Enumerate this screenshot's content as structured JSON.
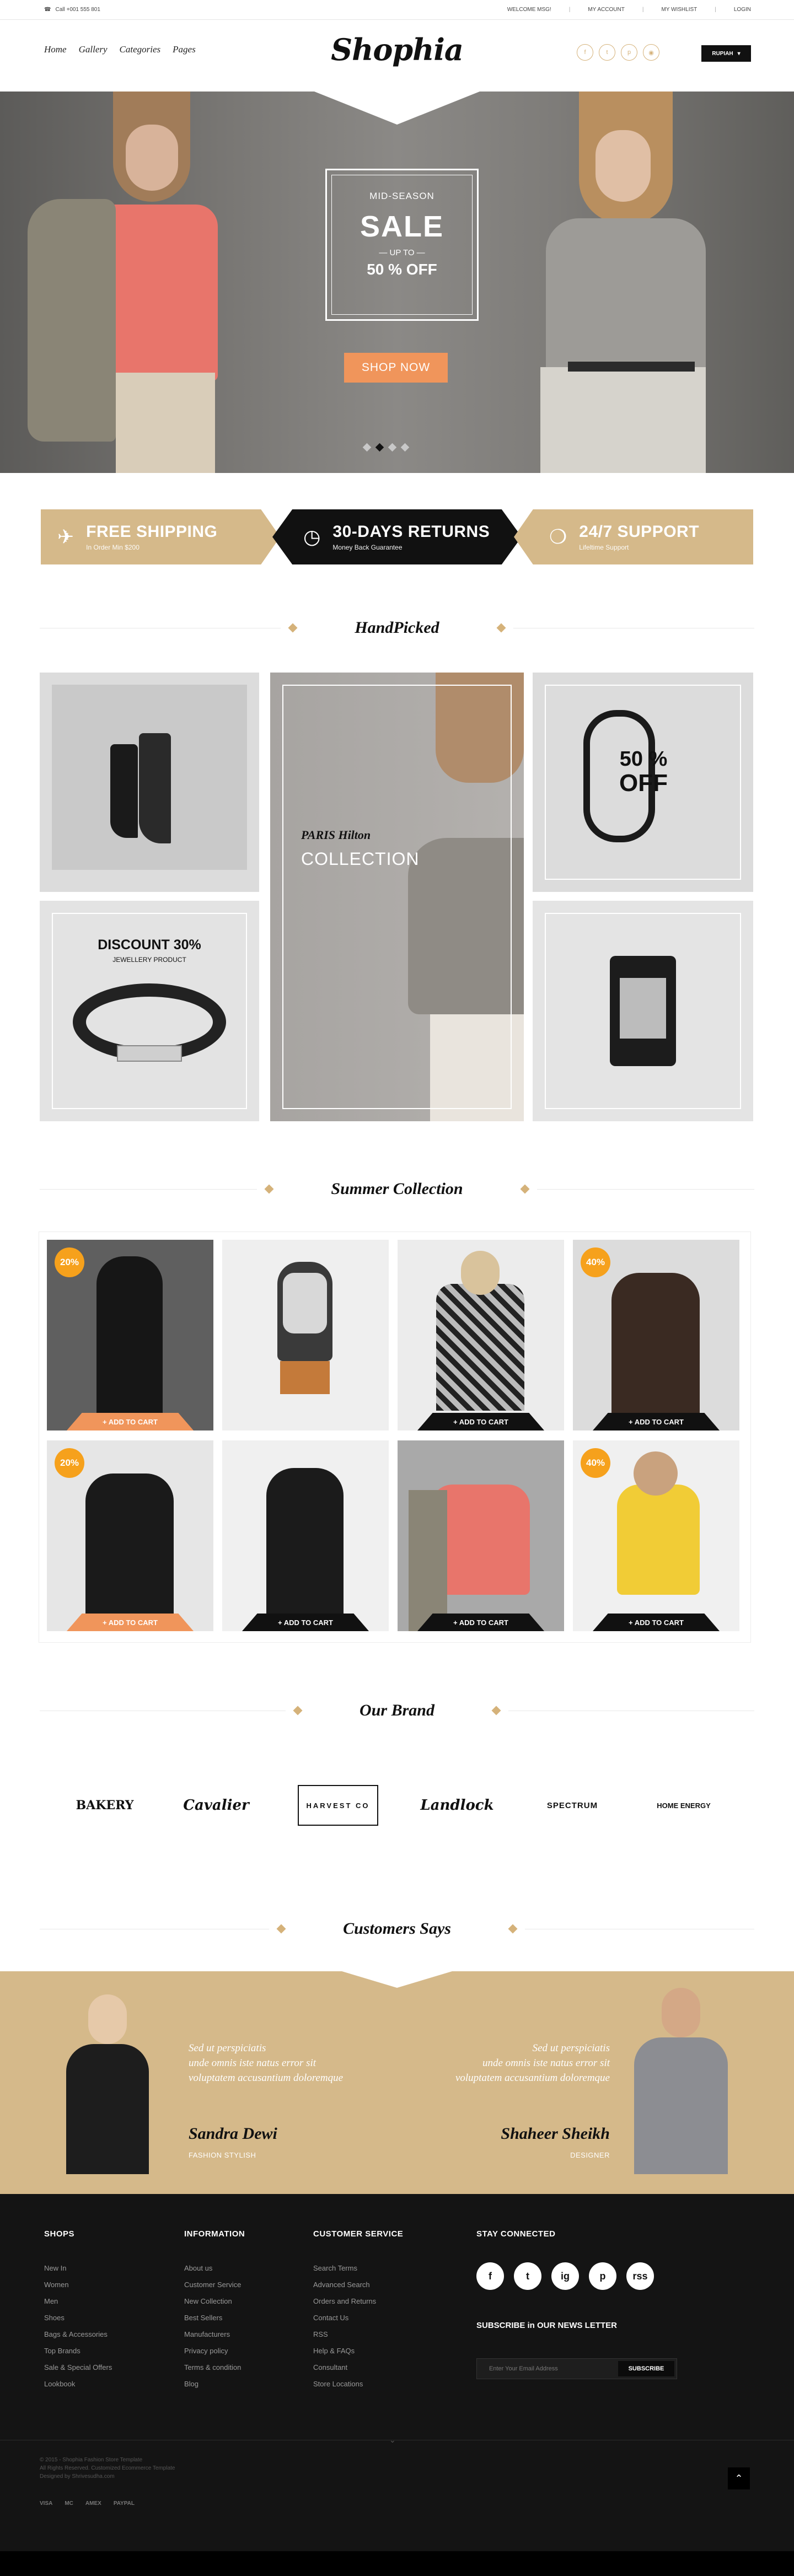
{
  "topbar": {
    "phone": "Call +001 555 801",
    "links": [
      "WELCOME MSG!",
      "MY ACCOUNT",
      "MY WISHLIST",
      "LOGIN"
    ]
  },
  "header": {
    "nav": [
      "Home",
      "Gallery",
      "Categories",
      "Pages"
    ],
    "logo": "Shophia",
    "currency": "RUPIAH"
  },
  "hero": {
    "mid": "MID-SEASON",
    "sale": "SALE",
    "upto": "UP TO",
    "off": "50 %   OFF",
    "cta": "SHOP NOW"
  },
  "features": [
    {
      "title": "FREE SHIPPING",
      "sub": "In Order Min $200",
      "color": "#d5b98a"
    },
    {
      "title": "30-DAYS RETURNS",
      "sub": "Money Back  Guarantee",
      "color": "#111111"
    },
    {
      "title": "24/7 SUPPORT",
      "sub": "Lifeltime Support",
      "color": "#d5b98a"
    }
  ],
  "sections": {
    "handpicked": "HandPicked",
    "summer": "Summer Collection",
    "brand": "Our Brand",
    "customers": "Customers Says"
  },
  "handpicked": {
    "paris": "PARIS Hilton",
    "collection": "COLLECTION",
    "fifty": "50 %",
    "off": "OFF",
    "discount": "DISCOUNT 30%",
    "jewellery": "JEWELLERY PRODUCT"
  },
  "products": [
    {
      "badge": "20%",
      "cart": "+ ADD TO CART",
      "cart_color": "#f0955b"
    },
    {
      "badge": "",
      "cart": "",
      "cart_color": ""
    },
    {
      "badge": "",
      "cart": "+ ADD TO CART",
      "cart_color": "#111111"
    },
    {
      "badge": "40%",
      "cart": "+ ADD TO CART",
      "cart_color": "#111111"
    },
    {
      "badge": "20%",
      "cart": "+ ADD TO CART",
      "cart_color": "#f0955b"
    },
    {
      "badge": "",
      "cart": "+ ADD TO CART",
      "cart_color": "#111111"
    },
    {
      "badge": "",
      "cart": "+ ADD TO CART",
      "cart_color": "#111111"
    },
    {
      "badge": "40%",
      "cart": "+ ADD TO CART",
      "cart_color": "#111111"
    }
  ],
  "brands": [
    "BAKERY",
    "Cavalier",
    "HARVEST CO",
    "Landlock",
    "SPECTRUM",
    "HOME ENERGY"
  ],
  "testimonials": [
    {
      "quote1": "Sed ut perspiciatis",
      "quote2": "unde omnis iste natus error sit",
      "quote3": "voluptatem accusantium doloremque",
      "name": "Sandra Dewi",
      "role": "FASHION STYLISH"
    },
    {
      "quote1": "Sed ut perspiciatis",
      "quote2": "unde omnis iste natus error sit",
      "quote3": "voluptatem accusantium doloremque",
      "name": "Shaheer Sheikh",
      "role": "DESIGNER"
    }
  ],
  "footer": {
    "shops": {
      "title": "SHOPS",
      "items": [
        "New In",
        "Women",
        "Men",
        "Shoes",
        "Bags & Accessories",
        "Top Brands",
        "Sale & Special Offers",
        "Lookbook"
      ]
    },
    "information": {
      "title": "INFORMATION",
      "items": [
        "About us",
        "Customer Service",
        "New Collection",
        "Best Sellers",
        "Manufacturers",
        "Privacy policy",
        "Terms & condition",
        "Blog"
      ]
    },
    "service": {
      "title": "CUSTOMER SERVICE",
      "items": [
        "Search Terms",
        "Advanced Search",
        "Orders and Returns",
        "Contact Us",
        "RSS",
        "Help & FAQs",
        "Consultant",
        "Store Locations"
      ]
    },
    "connected": "STAY CONNECTED",
    "socials": [
      "f",
      "t",
      "ig",
      "p",
      "rss"
    ],
    "subscribe": "SUBSCRIBE  in  OUR NEWS LETTER",
    "email_placeholder": "Enter Your Email Address",
    "subscribe_btn": "SUBSCRIBE",
    "copy1": "© 2015 - Shophia Fashion Store Template",
    "copy2": "All Rights Reserved. Customized Ecommerce Template",
    "copy3": "Designed by Shrivesudha.com",
    "payments": [
      "VISA",
      "MC",
      "AMEX",
      "PAYPAL"
    ]
  }
}
